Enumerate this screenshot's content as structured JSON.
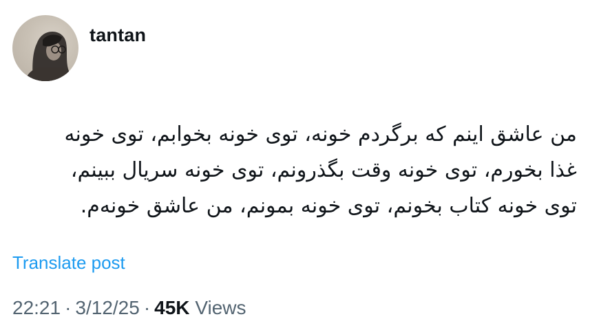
{
  "author": {
    "username": "tantan"
  },
  "post": {
    "lines": [
      "من عاشق اینم که برگردم خونه، توی خونه بخوابم، توی خونه",
      "غذا بخورم، توی خونه وقت بگذرونم، توی خونه سریال ببینم،",
      "توی خونه کتاب بخونم، توی خونه بمونم، من عاشق خونه‌م."
    ],
    "translate_label": "Translate post",
    "time": "22:21",
    "date": "3/12/25",
    "separator": "·",
    "views_count": "45K",
    "views_label": "Views"
  },
  "colors": {
    "link": "#1d9bf0",
    "meta": "#536471",
    "text": "#0f1419"
  }
}
